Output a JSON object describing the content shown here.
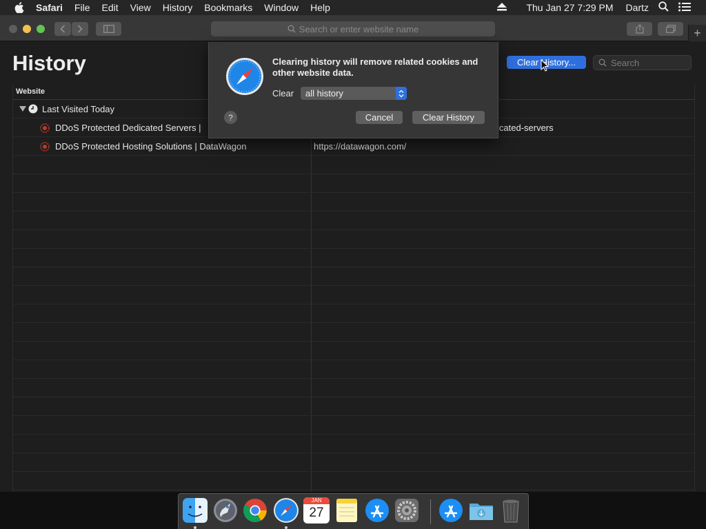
{
  "menubar": {
    "items": [
      "Safari",
      "File",
      "Edit",
      "View",
      "History",
      "Bookmarks",
      "Window",
      "Help"
    ],
    "datetime": "Thu Jan 27  7:29 PM",
    "user": "Dartz"
  },
  "toolbar": {
    "url_placeholder": "Search or enter website name"
  },
  "page": {
    "title": "History",
    "clear_history_button": "Clear History...",
    "search_placeholder": "Search"
  },
  "table": {
    "column_website": "Website",
    "group_label": "Last Visited Today",
    "rows": [
      {
        "title": "DDoS Protected Dedicated Servers |",
        "url": "icated-servers"
      },
      {
        "title": "DDoS Protected Hosting Solutions | DataWagon",
        "url": "https://datawagon.com/"
      }
    ]
  },
  "dialog": {
    "message": "Clearing history will remove related cookies and other website data.",
    "clear_label": "Clear",
    "clear_option": "all history",
    "help": "?",
    "cancel": "Cancel",
    "confirm": "Clear History"
  },
  "dock": {
    "calendar_month": "JAN",
    "calendar_day": "27"
  },
  "colors": {
    "accent": "#2f6fdd",
    "window_bg": "#1e1e1e",
    "toolbar_bg": "#373737",
    "dialog_bg": "#363636"
  }
}
